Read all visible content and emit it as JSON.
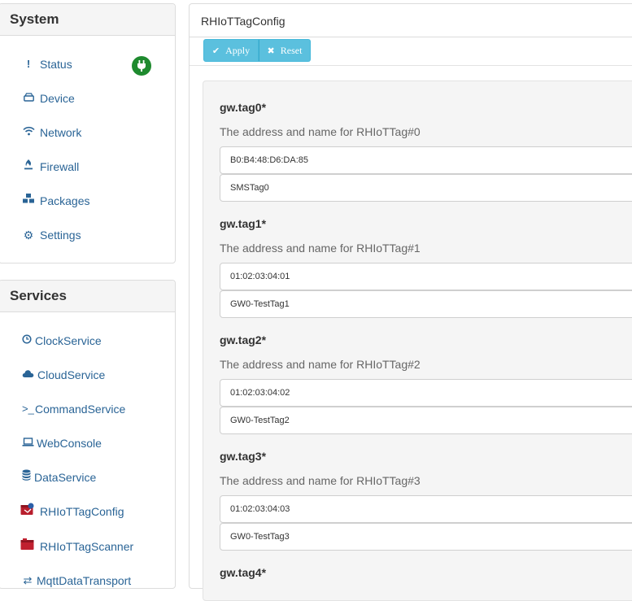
{
  "system": {
    "title": "System",
    "items": [
      {
        "label": "Status",
        "icon": "exclamation-icon"
      },
      {
        "label": "Device",
        "icon": "hdd-icon"
      },
      {
        "label": "Network",
        "icon": "wifi-icon"
      },
      {
        "label": "Firewall",
        "icon": "fire-icon"
      },
      {
        "label": "Packages",
        "icon": "cubes-icon"
      },
      {
        "label": "Settings",
        "icon": "gear-icon"
      }
    ],
    "status_color": "#1e8a2e"
  },
  "services": {
    "title": "Services",
    "items": [
      {
        "label": "ClockService",
        "icon": "clock-icon"
      },
      {
        "label": "CloudService",
        "icon": "cloud-icon"
      },
      {
        "label": "CommandService",
        "icon": "terminal-icon"
      },
      {
        "label": "WebConsole",
        "icon": "laptop-icon"
      },
      {
        "label": "DataService",
        "icon": "database-icon"
      },
      {
        "label": "RHIoTTagConfig",
        "icon": "plugin-config-icon"
      },
      {
        "label": "RHIoTTagScanner",
        "icon": "plugin-scanner-icon"
      },
      {
        "label": "MqttDataTransport",
        "icon": "transport-icon"
      }
    ]
  },
  "content": {
    "title": "RHIoTTagConfig",
    "toolbar": {
      "apply_label": "Apply",
      "reset_label": "Reset"
    },
    "tags": [
      {
        "name": "gw.tag0*",
        "description": "The address and name for RHIoTTag#0",
        "address": "B0:B4:48:D6:DA:85",
        "tag_name": "SMSTag0"
      },
      {
        "name": "gw.tag1*",
        "description": "The address and name for RHIoTTag#1",
        "address": "01:02:03:04:01",
        "tag_name": "GW0-TestTag1"
      },
      {
        "name": "gw.tag2*",
        "description": "The address and name for RHIoTTag#2",
        "address": "01:02:03:04:02",
        "tag_name": "GW0-TestTag2"
      },
      {
        "name": "gw.tag3*",
        "description": "The address and name for RHIoTTag#3",
        "address": "01:02:03:04:03",
        "tag_name": "GW0-TestTag3"
      },
      {
        "name": "gw.tag4*"
      }
    ]
  },
  "colors": {
    "link": "#2a6496",
    "button": "#5bc0de"
  }
}
